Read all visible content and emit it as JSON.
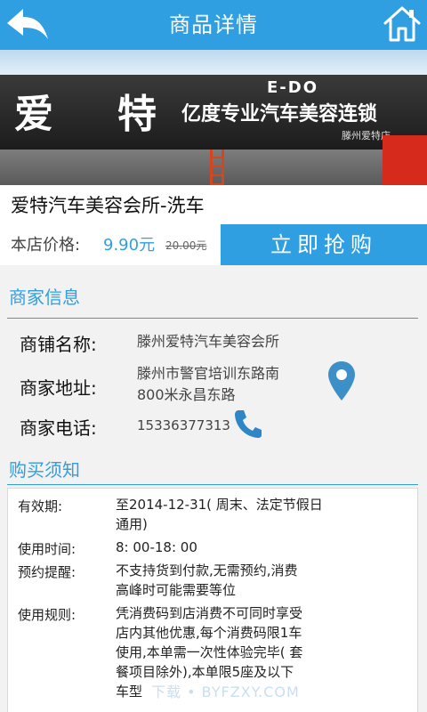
{
  "header": {
    "title": "商品详情",
    "back_icon": "back-arrow-icon",
    "home_icon": "home-icon"
  },
  "hero": {
    "sign_logo": [
      "爱",
      "特"
    ],
    "sign_en": "E-DO",
    "sign_cn": "亿度专业汽车美容连锁",
    "sign_sub": "滕州爱特店"
  },
  "product": {
    "name": "爱特汽车美容会所-洗车",
    "price_label": "本店价格:",
    "price": "9.90元",
    "original_price": "20.00元",
    "buy_label": "立即抢购"
  },
  "merchant": {
    "section_title": "商家信息",
    "shop_label": "商铺名称:",
    "shop_name": "滕州爱特汽车美容会所",
    "address_label": "商家地址:",
    "address_lines": [
      "滕州市警官培训东路南",
      "800米永昌东路"
    ],
    "phone_label": "商家电话:",
    "phone": "15336377313"
  },
  "notice": {
    "section_title": "购买须知",
    "items": [
      {
        "label": "有效期:",
        "lines": [
          "至2014-12-31(  周末、法定节假日",
          "通用)"
        ]
      },
      {
        "label": "使用时间:",
        "lines": [
          "8:  00-18:  00"
        ]
      },
      {
        "label": "预约提醒:",
        "lines": [
          "不支持货到付款,无需预约,消费",
          "高峰时可能需要等位"
        ]
      },
      {
        "label": "使用规则:",
        "lines": [
          "凭消费码到店消费不可同时享受",
          "店内其他优惠,每个消费码限1车",
          "使用,本单需一次性体验完毕(  套",
          "餐项目除外),本单限5座及以下",
          "车型"
        ]
      }
    ]
  },
  "watermark": "下载 • BYFZXY.COM",
  "colors": {
    "accent": "#2f9fe2",
    "background": "#f2f2f2"
  }
}
